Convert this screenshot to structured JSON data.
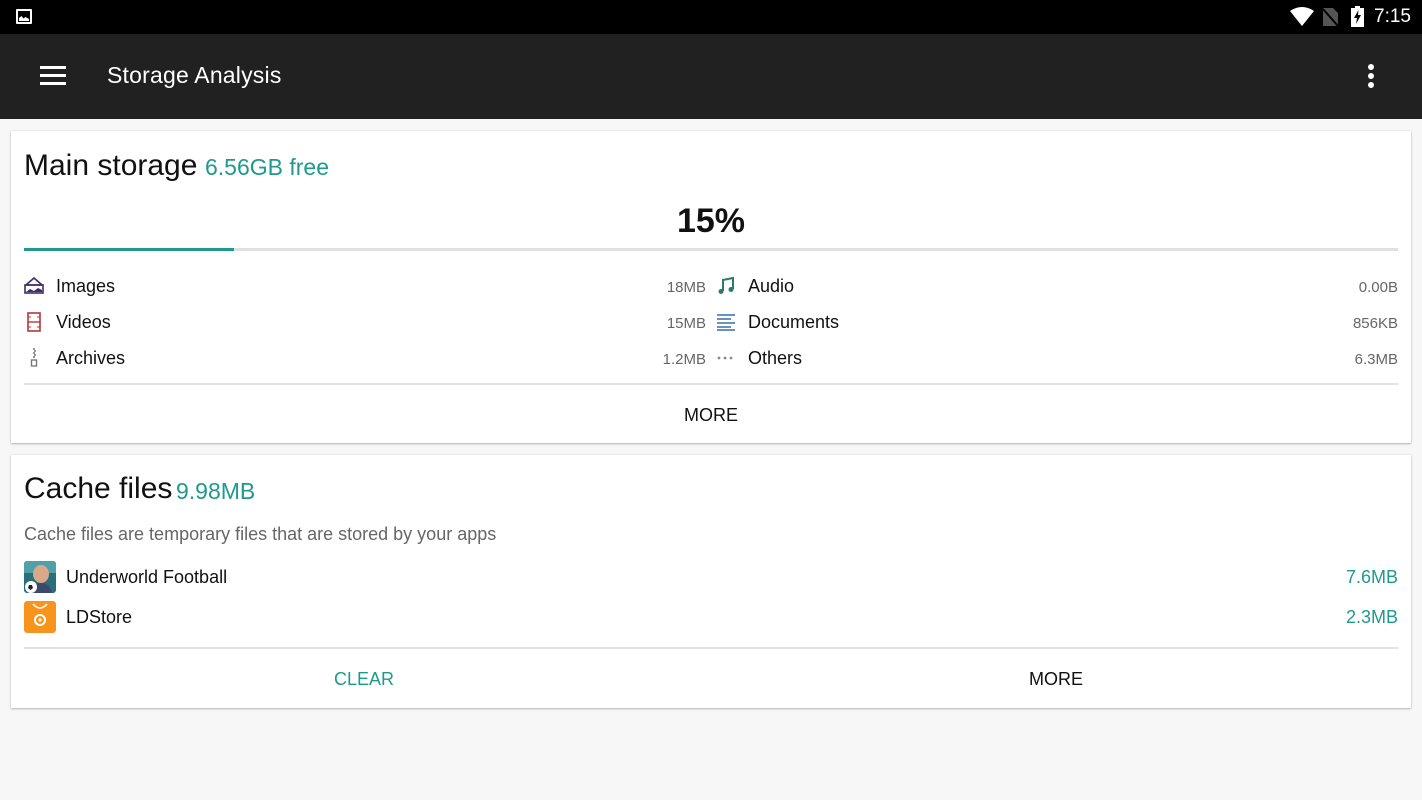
{
  "status_bar": {
    "time": "7:15",
    "icons": [
      "gallery-notification-icon",
      "wifi-icon",
      "no-sim-icon",
      "battery-charging-icon"
    ]
  },
  "app_bar": {
    "title": "Storage Analysis",
    "menu_icon": "hamburger-menu-icon",
    "overflow_icon": "more-vert-icon"
  },
  "main_storage": {
    "title": "Main storage",
    "free": "6.56GB free",
    "percent_label": "15%",
    "used_fraction": 0.153,
    "categories_left": [
      {
        "icon": "image-icon",
        "label": "Images",
        "size": "18MB",
        "color": "#3d2d6b"
      },
      {
        "icon": "video-film-icon",
        "label": "Videos",
        "size": "15MB",
        "color": "#b03a3a"
      },
      {
        "icon": "archive-zip-icon",
        "label": "Archives",
        "size": "1.2MB",
        "color": "#777777"
      }
    ],
    "categories_right": [
      {
        "icon": "music-note-icon",
        "label": "Audio",
        "size": "0.00B",
        "color": "#2b7a6e"
      },
      {
        "icon": "document-lines-icon",
        "label": "Documents",
        "size": "856KB",
        "color": "#3a6fa8"
      },
      {
        "icon": "more-horiz-icon",
        "label": "Others",
        "size": "6.3MB",
        "color": "#888888"
      }
    ],
    "more_label": "MORE"
  },
  "cache_files": {
    "title": "Cache files",
    "total": "9.98MB",
    "description": "Cache files are temporary files that are stored by your apps",
    "apps": [
      {
        "icon": "underworld-football-app-icon",
        "name": "Underworld Football",
        "size": "7.6MB"
      },
      {
        "icon": "ldstore-app-icon",
        "name": "LDStore",
        "size": "2.3MB"
      }
    ],
    "clear_label": "CLEAR",
    "more_label": "MORE"
  },
  "colors": {
    "accent": "#1e9a8b",
    "app_bar": "#212121",
    "status_bar": "#000000",
    "background": "#f7f7f7"
  }
}
